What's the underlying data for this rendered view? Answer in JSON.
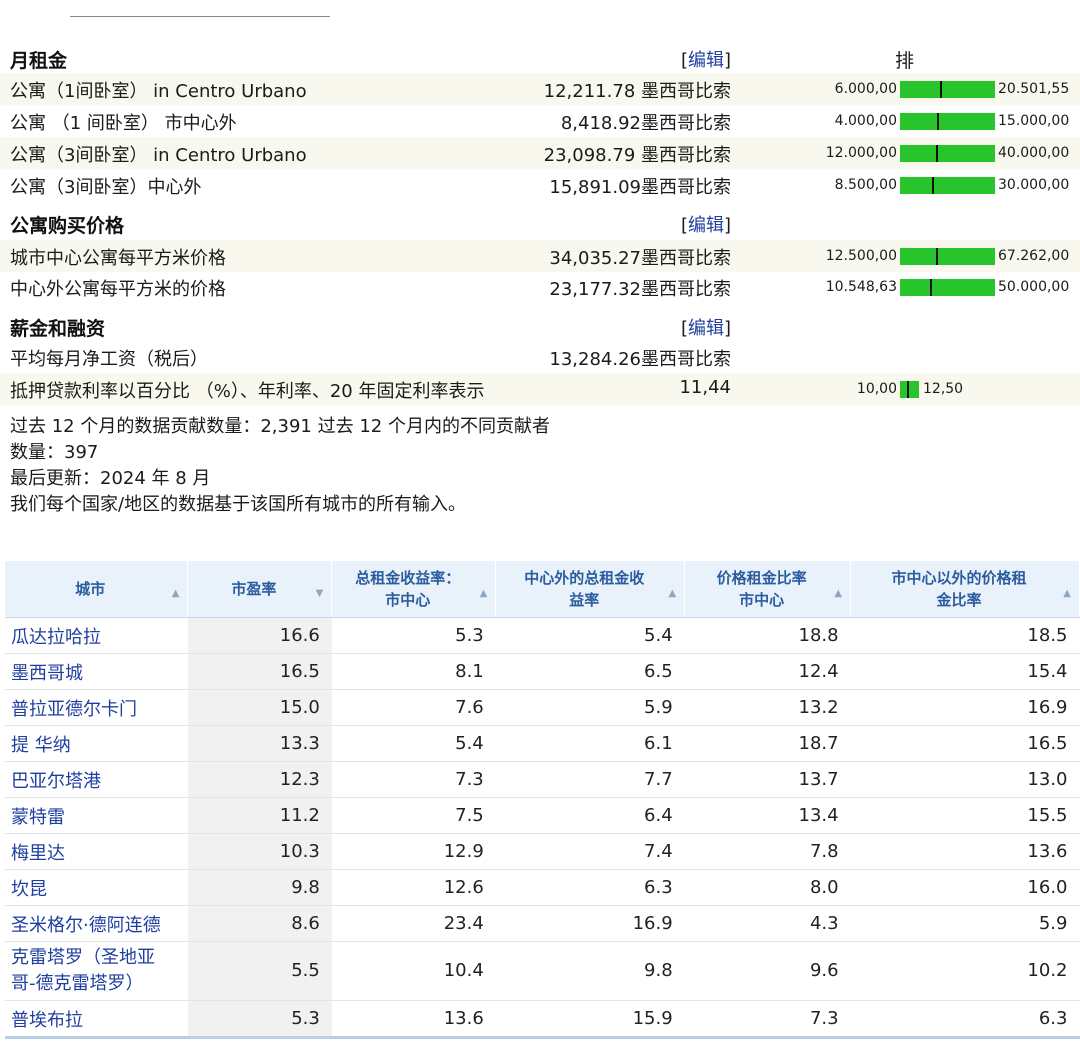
{
  "rent_section": {
    "title": "月租金",
    "edit": "编辑",
    "rank_header": "排",
    "rows": [
      {
        "label": "公寓（1间卧室） in Centro Urbano",
        "value": "12,211.78 墨西哥比索",
        "range_min": "6.000,00",
        "range_max": "20.501,55",
        "position": 0.4
      },
      {
        "label": "公寓 （1 间卧室） 市中心外",
        "value": "8,418.92墨西哥比索",
        "range_min": "4.000,00",
        "range_max": "15.000,00",
        "position": 0.38
      },
      {
        "label": "公寓（3间卧室） in Centro Urbano",
        "value": "23,098.79 墨西哥比索",
        "range_min": "12.000,00",
        "range_max": "40.000,00",
        "position": 0.37
      },
      {
        "label": "公寓（3间卧室）中心外",
        "value": "15,891.09墨西哥比索",
        "range_min": "8.500,00",
        "range_max": "30.000,00",
        "position": 0.34
      }
    ]
  },
  "buy_section": {
    "title": "公寓购买价格",
    "edit": "编辑",
    "rows": [
      {
        "label": "城市中心公寓每平方米价格",
        "value": "34,035.27墨西哥比索",
        "range_min": "12.500,00",
        "range_max": "67.262,00",
        "position": 0.38
      },
      {
        "label": "中心外公寓每平方米的价格",
        "value": "23,177.32墨西哥比索",
        "range_min": "10.548,63",
        "range_max": "50.000,00",
        "position": 0.32
      }
    ]
  },
  "salary_section": {
    "title": "薪金和融资",
    "edit": "编辑",
    "net_salary_label": "平均每月净工资（税后）",
    "net_salary_value": "13,284.26墨西哥比索",
    "mortgage_label": "抵押贷款利率以百分比 （%）、年利率、20 年固定利率表示",
    "mortgage_value": "11,44",
    "mortgage_min": "10,00",
    "mortgage_max": "12,50"
  },
  "notes": {
    "line1": "过去 12 个月的数据贡献数量：2,391 过去 12 个月内的不同贡献者",
    "line2": "数量：397",
    "line3": "最后更新：2024 年 8 月",
    "line4": "我们每个国家/地区的数据基于该国所有城市的所有输入。"
  },
  "table": {
    "headers": [
      {
        "line1": "城市",
        "line2": "",
        "sort": "▲"
      },
      {
        "line1": "市盈率",
        "line2": "",
        "sort": "▼"
      },
      {
        "line1": "总租金收益率：",
        "line2": "市中心",
        "sort": "▲"
      },
      {
        "line1": "中心外的总租金收",
        "line2": "益率",
        "sort": "▲"
      },
      {
        "line1": "价格租金比率",
        "line2": "市中心",
        "sort": "▲"
      },
      {
        "line1": "市中心以外的价格租",
        "line2": "金比率",
        "sort": "▲"
      }
    ],
    "rows": [
      {
        "city": "瓜达拉哈拉",
        "pe": "16.6",
        "gy_c": "5.3",
        "gy_o": "5.4",
        "pr_c": "18.8",
        "pr_o": "18.5"
      },
      {
        "city": "墨西哥城",
        "pe": "16.5",
        "gy_c": "8.1",
        "gy_o": "6.5",
        "pr_c": "12.4",
        "pr_o": "15.4"
      },
      {
        "city": "普拉亚德尔卡门",
        "pe": "15.0",
        "gy_c": "7.6",
        "gy_o": "5.9",
        "pr_c": "13.2",
        "pr_o": "16.9"
      },
      {
        "city": "提 华纳",
        "pe": "13.3",
        "gy_c": "5.4",
        "gy_o": "6.1",
        "pr_c": "18.7",
        "pr_o": "16.5"
      },
      {
        "city": "巴亚尔塔港",
        "pe": "12.3",
        "gy_c": "7.3",
        "gy_o": "7.7",
        "pr_c": "13.7",
        "pr_o": "13.0"
      },
      {
        "city": "蒙特雷",
        "pe": "11.2",
        "gy_c": "7.5",
        "gy_o": "6.4",
        "pr_c": "13.4",
        "pr_o": "15.5"
      },
      {
        "city": "梅里达",
        "pe": "10.3",
        "gy_c": "12.9",
        "gy_o": "7.4",
        "pr_c": "7.8",
        "pr_o": "13.6"
      },
      {
        "city": "坎昆",
        "pe": "9.8",
        "gy_c": "12.6",
        "gy_o": "6.3",
        "pr_c": "8.0",
        "pr_o": "16.0"
      },
      {
        "city": "圣米格尔·德阿连德",
        "pe": "8.6",
        "gy_c": "23.4",
        "gy_o": "16.9",
        "pr_c": "4.3",
        "pr_o": "5.9"
      },
      {
        "city": "克雷塔罗（圣地亚",
        "city2": "哥-德克雷塔罗）",
        "pe": "5.5",
        "gy_c": "10.4",
        "gy_o": "9.8",
        "pr_c": "9.6",
        "pr_o": "10.2"
      },
      {
        "city": "普埃布拉",
        "pe": "5.3",
        "gy_c": "13.6",
        "gy_o": "15.9",
        "pr_c": "7.3",
        "pr_o": "6.3"
      }
    ]
  },
  "colors": {
    "bar": "#28c42c",
    "link": "#1f3fa0",
    "header_bg": "#e9f2fb",
    "header_text": "#2b5c9e"
  }
}
